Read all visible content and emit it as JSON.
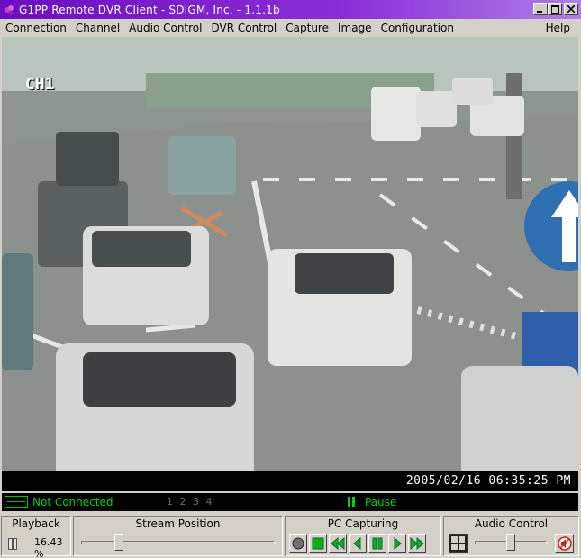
{
  "window": {
    "title": "G1PP Remote DVR Client - SDIGM, Inc. - 1.1.1b",
    "minimize_icon": "minimize-icon",
    "maximize_icon": "maximize-icon",
    "close_icon": "close-icon"
  },
  "menu": {
    "items": [
      "Connection",
      "Channel",
      "Audio Control",
      "DVR Control",
      "Capture",
      "Image",
      "Configuration"
    ],
    "help": "Help"
  },
  "video": {
    "channel_label": "CH1",
    "timestamp": "2005/02/16 06:35:25 PM"
  },
  "status": {
    "connection": "Not Connected",
    "channels": "1 2 3 4",
    "state": "Pause",
    "status_color": "#00d000"
  },
  "playback": {
    "title": "Playback",
    "percent": "16.43 %"
  },
  "stream_position": {
    "title": "Stream Position",
    "fraction": 0.18
  },
  "pc_capturing": {
    "title": "PC Capturing",
    "buttons": [
      "record",
      "stop",
      "fast-rewind",
      "step-back",
      "pause",
      "step-forward",
      "fast-forward"
    ]
  },
  "audio_control": {
    "title": "Audio Control",
    "volume_fraction": 0.5
  }
}
